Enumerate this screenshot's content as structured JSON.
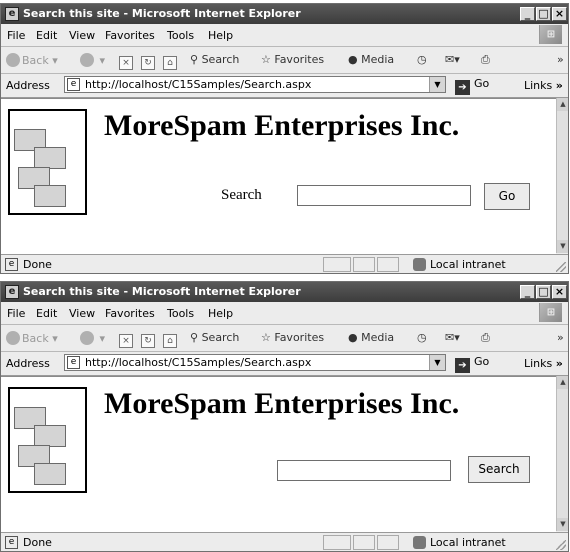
{
  "window": {
    "title": "Search this site - Microsoft Internet Explorer",
    "controls": {
      "minimize": "_",
      "maximize": "□",
      "close": "×"
    }
  },
  "menu": [
    "File",
    "Edit",
    "View",
    "Favorites",
    "Tools",
    "Help"
  ],
  "toolbar": {
    "back": "Back",
    "search": "Search",
    "favorites": "Favorites",
    "media": "Media"
  },
  "address": {
    "label": "Address",
    "url": "http://localhost/C15Samples/Search.aspx",
    "go": "Go",
    "links": "Links",
    "overflow": "»"
  },
  "page": {
    "company": "MoreSpam Enterprises Inc."
  },
  "screens": [
    {
      "search_label": "Search",
      "search_value": "",
      "button_label": "Go"
    },
    {
      "search_label": "",
      "search_value": "",
      "button_label": "Search"
    }
  ],
  "status": {
    "text": "Done",
    "zone": "Local intranet"
  }
}
